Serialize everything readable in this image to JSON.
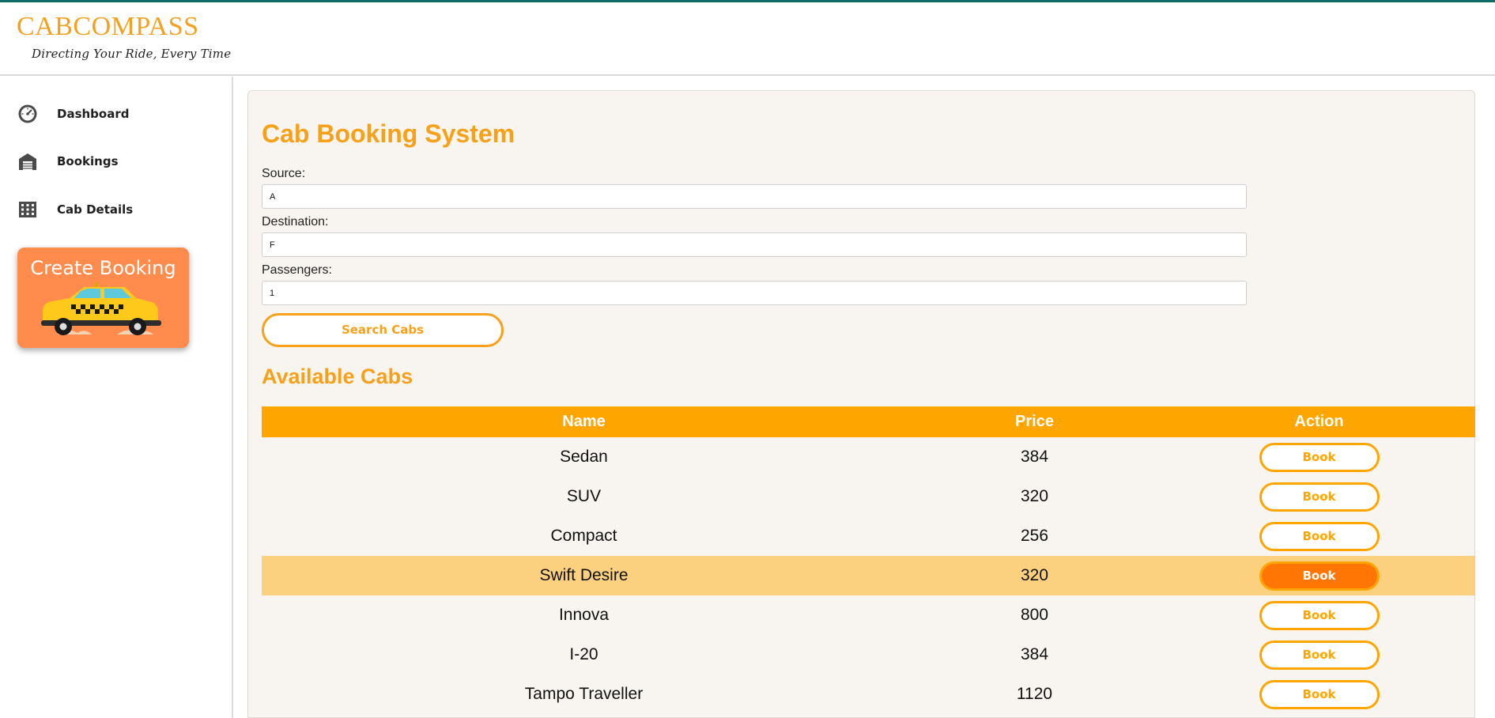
{
  "brand": {
    "name": "CABCOMPASS",
    "tagline": "Directing Your Ride, Every Time"
  },
  "sidebar": {
    "items": [
      {
        "label": "Dashboard",
        "icon": "speedometer-icon"
      },
      {
        "label": "Bookings",
        "icon": "garage-icon"
      },
      {
        "label": "Cab Details",
        "icon": "grid-icon"
      }
    ],
    "create_booking": {
      "label": "Create Booking",
      "icon": "taxi-icon"
    }
  },
  "form": {
    "title": "Cab Booking System",
    "source_label": "Source:",
    "source_value": "A",
    "destination_label": "Destination:",
    "destination_value": "F",
    "passengers_label": "Passengers:",
    "passengers_value": "1",
    "search_label": "Search Cabs"
  },
  "results": {
    "title": "Available Cabs",
    "columns": [
      "Name",
      "Price",
      "Action"
    ],
    "rows": [
      {
        "name": "Sedan",
        "price": "384",
        "action": "Book"
      },
      {
        "name": "SUV",
        "price": "320",
        "action": "Book"
      },
      {
        "name": "Compact",
        "price": "256",
        "action": "Book"
      },
      {
        "name": "Swift Desire",
        "price": "320",
        "action": "Book"
      },
      {
        "name": "Innova",
        "price": "800",
        "action": "Book"
      },
      {
        "name": "I-20",
        "price": "384",
        "action": "Book"
      },
      {
        "name": "Tampo Traveller",
        "price": "1120",
        "action": "Book"
      }
    ],
    "highlighted_row": "Swift Desire"
  },
  "colors": {
    "accent": "#f7a11a",
    "table_header": "#ffa500",
    "highlight_row": "#fbd07e",
    "active_button": "#ff7605",
    "create_card": "#ff8c4c",
    "top_line": "#0d6b68"
  }
}
